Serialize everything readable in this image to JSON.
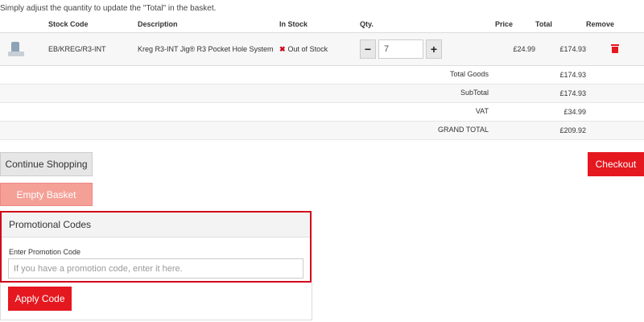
{
  "intro_text": "Simply adjust the quantity to update the \"Total\" in the basket.",
  "columns": {
    "stock_code": "Stock Code",
    "description": "Description",
    "in_stock": "In Stock",
    "qty": "Qty.",
    "price": "Price",
    "total": "Total",
    "remove": "Remove"
  },
  "item": {
    "image_icon": "product-thumbnail",
    "stock_code": "EB/KREG/R3-INT",
    "description": "Kreg R3-INT Jig® R3 Pocket Hole System",
    "stock_status": "Out of Stock",
    "stock_icon": "x-mark",
    "qty_minus": "−",
    "qty_value": "7",
    "qty_plus": "+",
    "price": "£24.99",
    "total": "£174.93",
    "remove_icon": "trash-icon"
  },
  "summary": [
    {
      "label": "Total Goods",
      "value": "£174.93"
    },
    {
      "label": "SubTotal",
      "value": "£174.93"
    },
    {
      "label": "VAT",
      "value": "£34.99"
    },
    {
      "label": "GRAND TOTAL",
      "value": "£209.92"
    }
  ],
  "buttons": {
    "continue": "Continue Shopping",
    "checkout": "Checkout",
    "empty": "Empty Basket",
    "apply": "Apply Code"
  },
  "promo": {
    "title": "Promotional Codes",
    "label": "Enter Promotion Code",
    "placeholder": "If you have a promotion code, enter it here."
  },
  "colors": {
    "accent": "#e5171f",
    "highlight_border": "#d0021b",
    "empty_button": "#f4a097"
  }
}
